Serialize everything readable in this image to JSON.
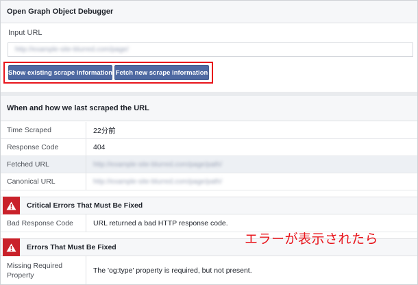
{
  "debugger": {
    "title": "Open Graph Object Debugger",
    "input_label": "Input URL",
    "input_value_redacted": "http://example-site-blurred.com/page/",
    "buttons": {
      "show_existing": "Show existing scrape information",
      "fetch_new": "Fetch new scrape information"
    }
  },
  "scrape_info": {
    "heading": "When and how we last scraped the URL",
    "rows": [
      {
        "key": "Time Scraped",
        "value": "22分前"
      },
      {
        "key": "Response Code",
        "value": "404"
      },
      {
        "key": "Fetched URL",
        "value": "http://example-site-blurred.com/page/path/"
      },
      {
        "key": "Canonical URL",
        "value": "http://example-site-blurred.com/page/path/"
      }
    ]
  },
  "critical_errors": {
    "heading": "Critical Errors That Must Be Fixed",
    "rows": [
      {
        "key": "Bad Response Code",
        "value": "URL returned a bad HTTP response code."
      }
    ]
  },
  "errors": {
    "heading": "Errors That Must Be Fixed",
    "rows": [
      {
        "key": "Missing Required Property",
        "value": "The 'og:type' property is required, but not present."
      }
    ]
  },
  "annotation": "エラーが表示されたら",
  "colors": {
    "button_blue": "#4e69a2",
    "error_red": "#c9212a",
    "highlight_red": "#e8141b",
    "header_bg": "#f6f7f9",
    "alt_row_bg": "#edf0f4"
  },
  "icons": {
    "error": "warning-triangle-icon"
  }
}
